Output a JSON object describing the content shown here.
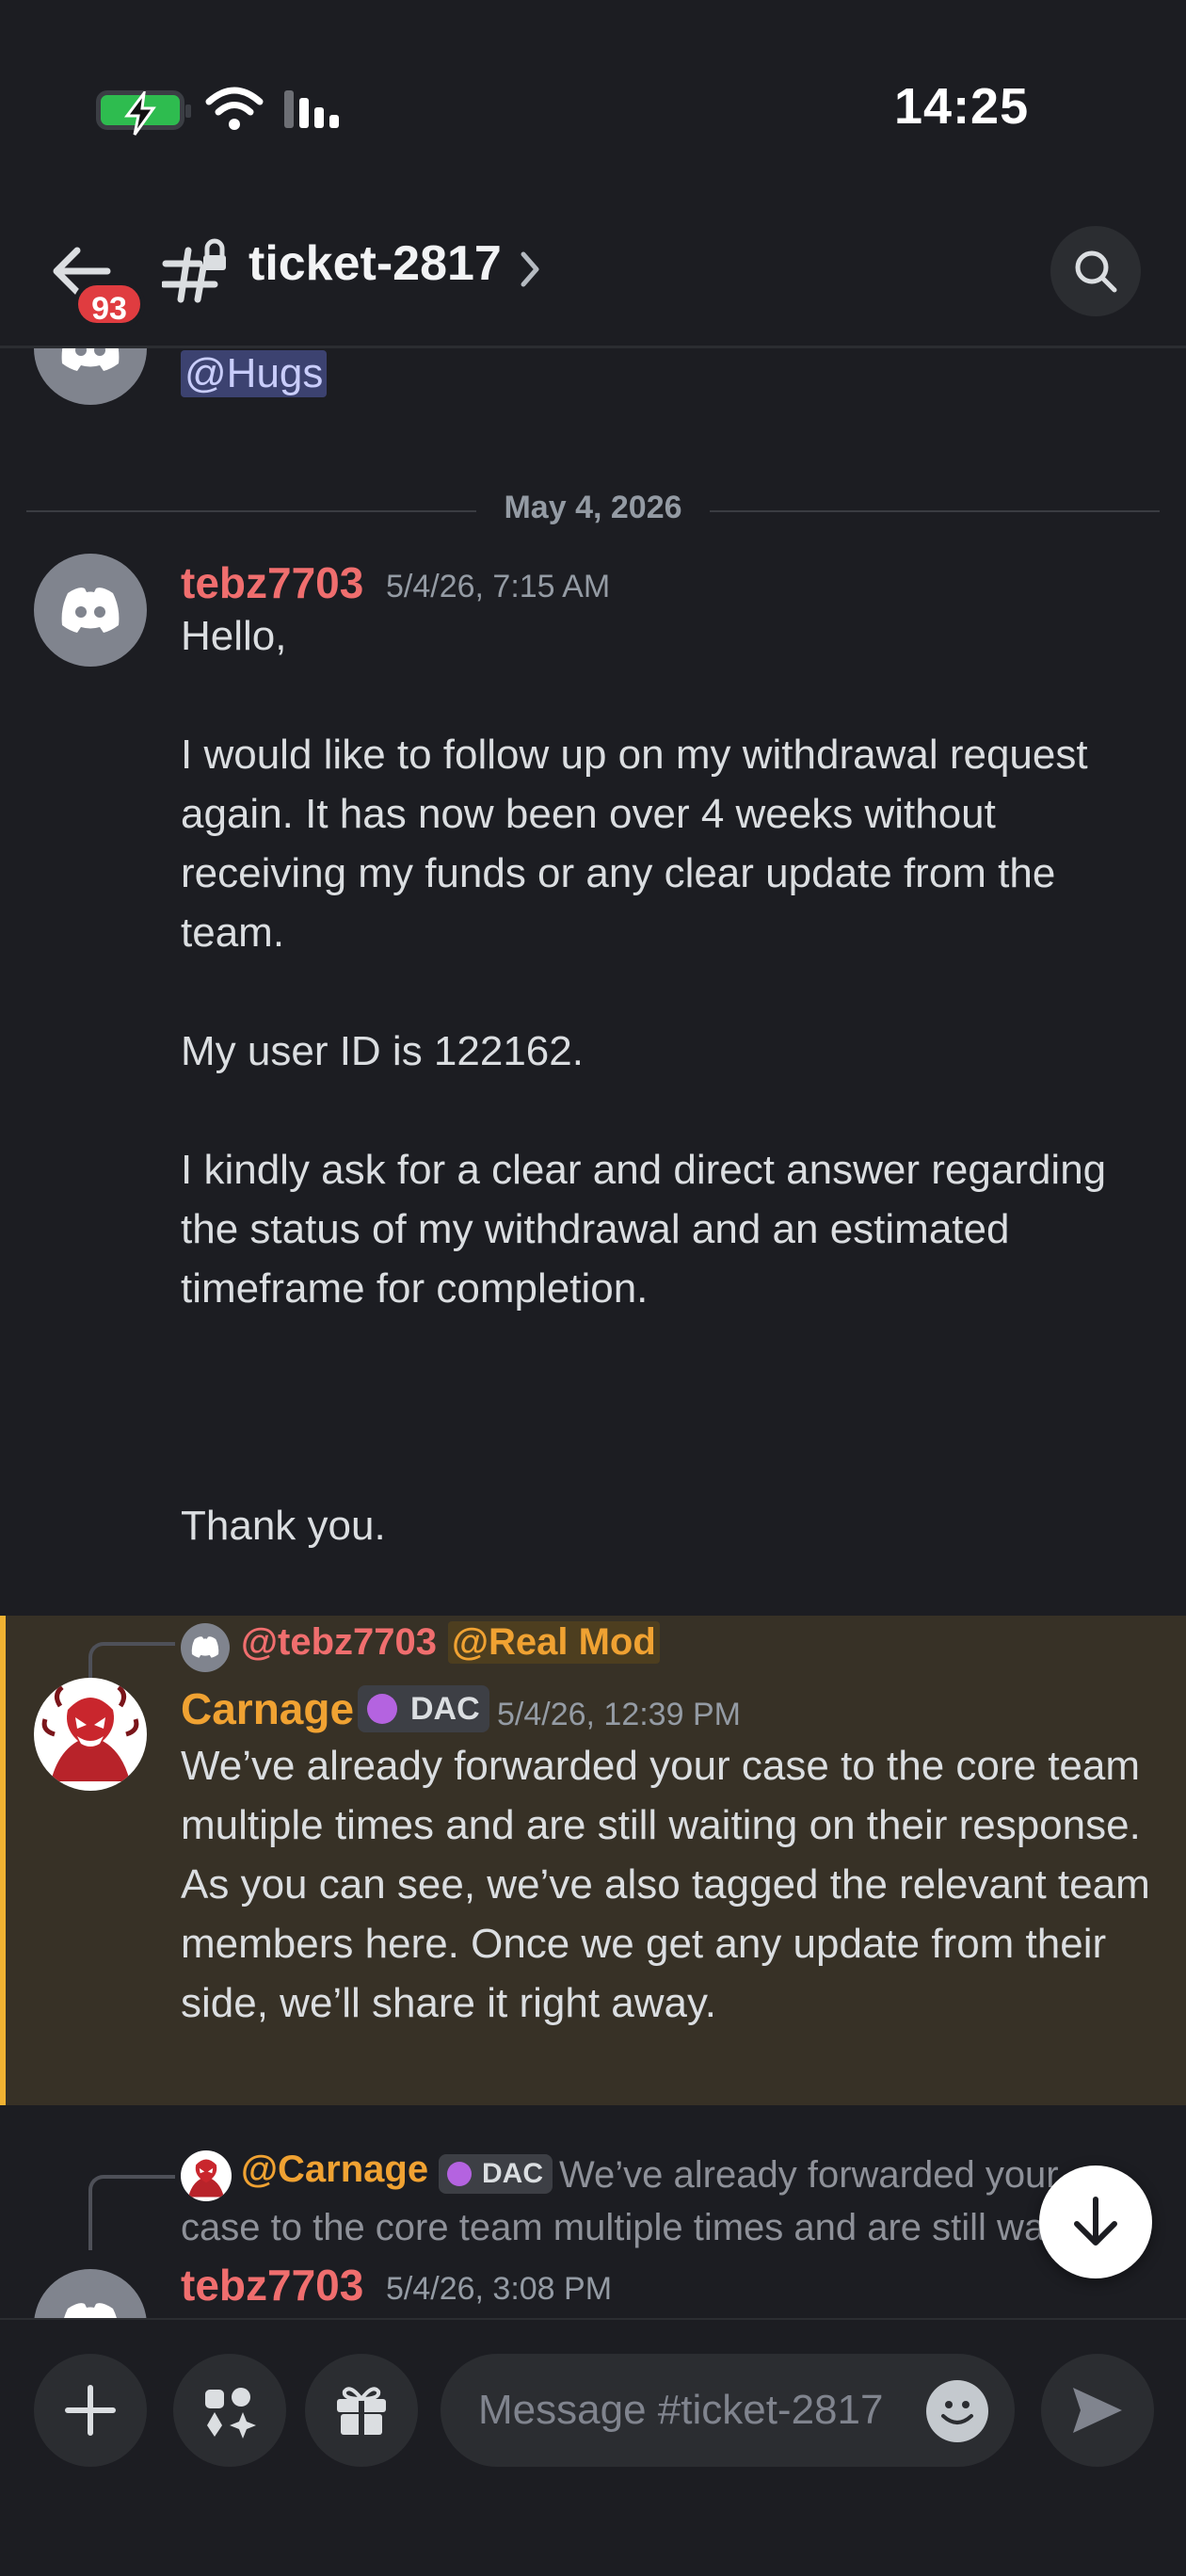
{
  "status": {
    "time": "14:25"
  },
  "header": {
    "unread_count": "93",
    "channel_name": "ticket-2817"
  },
  "chat": {
    "prev_mention": "@Hugs",
    "date_divider": "May 4, 2026",
    "message1": {
      "author": "tebz7703",
      "timestamp": "5/4/26, 7:15 AM",
      "text": "Hello,\n\nI would like to follow up on my withdrawal request again. It has now been over 4 weeks without receiving my funds or any clear update from the team.\n\nMy user ID is 122162.\n\nI kindly ask for a clear and direct answer regarding the status of my withdrawal and an estimated timeframe for completion.\n\n\n\nThank you."
    },
    "message2": {
      "reply_ping_user": "@tebz7703",
      "reply_ping_role": "@Real Mod",
      "author": "Carnage",
      "role_tag": "DAC",
      "timestamp": "5/4/26, 12:39 PM",
      "text": "We’ve already forwarded your case to the core team multiple times and are still waiting on their response.\nAs you can see, we’ve also tagged the relevant team members here. Once we get any update from their side, we’ll share it right away."
    },
    "message3": {
      "reply_author": "@Carnage",
      "reply_role_tag": "DAC",
      "reply_preview": "We’ve already forwarded your case to the core team multiple times and are still waiting on their response.",
      "author": "tebz7703",
      "timestamp": "5/4/26, 3:08 PM"
    }
  },
  "composer": {
    "placeholder": "Message #ticket-2817"
  },
  "colors": {
    "background": "#1c1d22",
    "username_tebz": "#f06e6e",
    "username_carnage": "#f0a232",
    "highlight_bg": "#373126",
    "highlight_bar": "#f0b232",
    "badge_red": "#e03c40"
  }
}
